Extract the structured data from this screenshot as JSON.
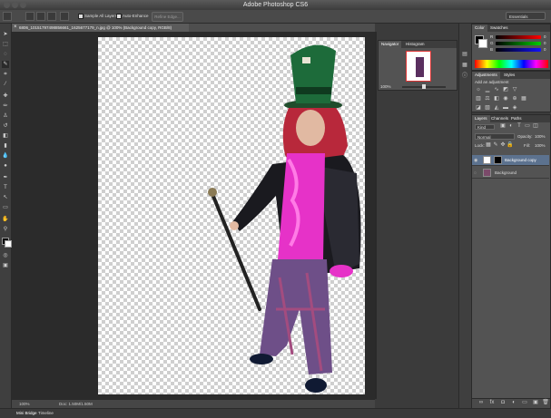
{
  "app": {
    "title": "Adobe Photoshop CS6"
  },
  "options_bar": {
    "sample_all_layers": "Sample All Layers",
    "auto_enhance": "Auto-Enhance",
    "refine_edge": "Refine Edge...",
    "workspace": "Essentials"
  },
  "document": {
    "tab_title": "6806_10151797498856661_1625677179_n.jpg @ 100% (Background copy, RGB/8)",
    "close_glyph": "×"
  },
  "status": {
    "zoom": "100%",
    "doc_size": "Doc: 1.50M/1.50M"
  },
  "bottom_tabs": [
    "Mini Bridge",
    "Timeline"
  ],
  "navigator": {
    "tabs": [
      "Navigator",
      "Histogram"
    ],
    "zoom": "100%"
  },
  "color_panel": {
    "tabs": [
      "Color",
      "Swatches"
    ],
    "channels": [
      {
        "label": "R",
        "value": "0"
      },
      {
        "label": "G",
        "value": "0"
      },
      {
        "label": "B",
        "value": "0"
      }
    ]
  },
  "adjustments": {
    "tabs": [
      "Adjustments",
      "Styles"
    ],
    "add_label": "Add an adjustment"
  },
  "layers_panel": {
    "tabs": [
      "Layers",
      "Channels",
      "Paths"
    ],
    "kind": "Kind",
    "blend_mode": "Normal",
    "opacity_label": "Opacity:",
    "opacity_value": "100%",
    "lock_label": "Lock:",
    "fill_label": "Fill:",
    "fill_value": "100%",
    "layers": [
      {
        "name": "Background copy",
        "selected": true
      },
      {
        "name": "Background",
        "selected": false
      }
    ]
  },
  "colors": {
    "accent_selected": "#5c728f",
    "foreground": "#000000",
    "background": "#ffffff"
  }
}
